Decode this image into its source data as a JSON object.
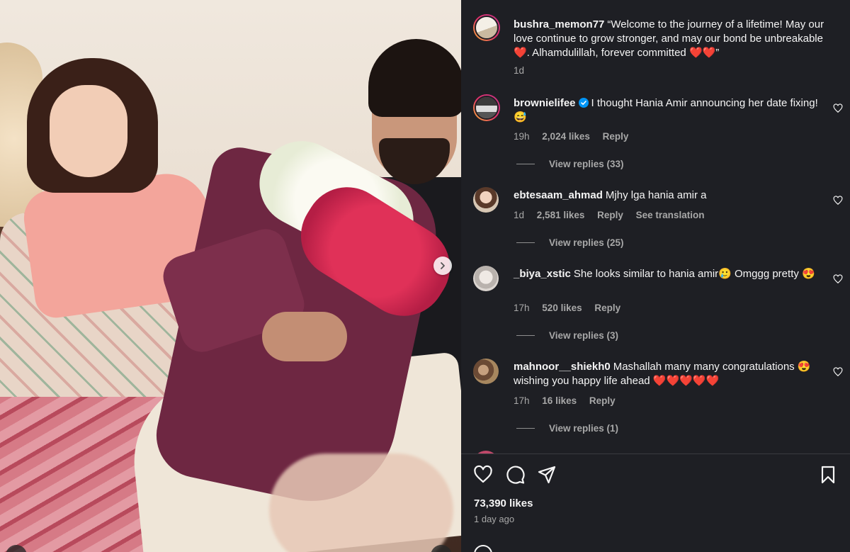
{
  "post": {
    "caption": {
      "username": "bushra_memon77",
      "text": "“Welcome to the journey of a lifetime! May our love continue to grow stronger, and may our bond be unbreakable ❤️. Alhamdulillah, forever committed ❤️❤️”",
      "time": "1d"
    },
    "likes": "73,390 likes",
    "time_ago": "1 day ago"
  },
  "comments": [
    {
      "username": "brownielifee",
      "verified": true,
      "text": "I thought Hania Amir announcing her date fixing! 😅",
      "time": "19h",
      "likes": "2,024 likes",
      "reply_label": "Reply",
      "view_replies": "View replies (33)"
    },
    {
      "username": "ebtesaam_ahmad",
      "verified": false,
      "text": "Mjhy lga hania amir a",
      "time": "1d",
      "likes": "2,581 likes",
      "reply_label": "Reply",
      "translation_label": "See translation",
      "view_replies": "View replies (25)"
    },
    {
      "username": "_biya_xstic",
      "verified": false,
      "text": "She looks similar to hania amir🥲 Omggg pretty 😍",
      "time": "17h",
      "likes": "520 likes",
      "reply_label": "Reply",
      "view_replies": "View replies (3)"
    },
    {
      "username": "mahnoor__shiekh0",
      "verified": false,
      "text": "Mashallah many many congratulations 😍 wishing you happy life ahead ❤️❤️❤️❤️❤️",
      "time": "17h",
      "likes": "16 likes",
      "reply_label": "Reply",
      "view_replies": "View replies (1)"
    }
  ],
  "icons": {
    "like": "heart-icon",
    "comment": "comment-icon",
    "share": "share-icon",
    "save": "bookmark-icon",
    "next": "chevron-right-icon"
  },
  "colors": {
    "panel_bg": "#1e1f24",
    "text": "#f5f5f5",
    "muted": "#a8a8a8",
    "verified": "#0095f6"
  }
}
